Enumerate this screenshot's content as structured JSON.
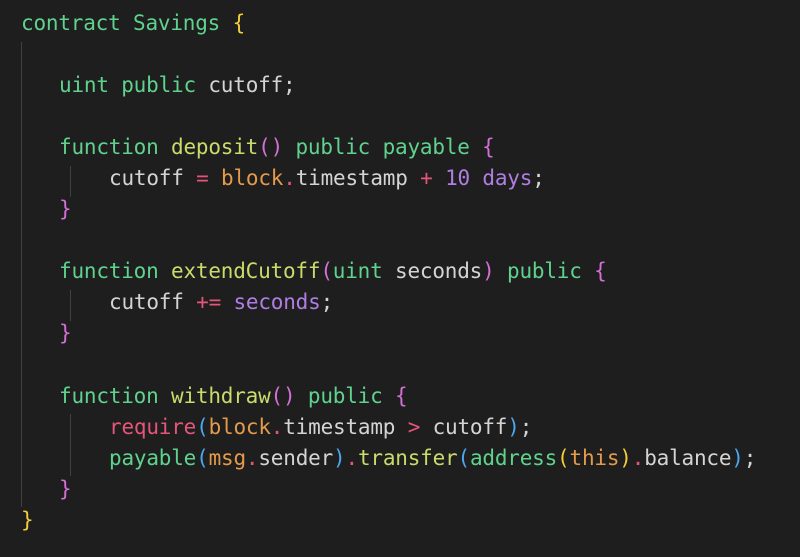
{
  "code": {
    "l1": {
      "t1": "contract",
      "t2": "Savings",
      "t3": "{"
    },
    "l2": {
      "t1": "uint",
      "t2": "public",
      "t3": "cutoff",
      "t4": ";"
    },
    "l3": {
      "t1": "function",
      "t2": "deposit",
      "t3": "(",
      "t4": ")",
      "t5": "public",
      "t6": "payable",
      "t7": "{"
    },
    "l4": {
      "t1": "cutoff",
      "t2": "=",
      "t3": "block",
      "t4": ".",
      "t5": "timestamp",
      "t6": "+",
      "t7": "10",
      "t8": "days",
      "t9": ";"
    },
    "l5": {
      "t1": "}"
    },
    "l6": {
      "t1": "function",
      "t2": "extendCutoff",
      "t3": "(",
      "t4": "uint",
      "t5": "seconds",
      "t6": ")",
      "t7": "public",
      "t8": "{"
    },
    "l7": {
      "t1": "cutoff",
      "t2": "+=",
      "t3": "seconds",
      "t4": ";"
    },
    "l8": {
      "t1": "}"
    },
    "l9": {
      "t1": "function",
      "t2": "withdraw",
      "t3": "(",
      "t4": ")",
      "t5": "public",
      "t6": "{"
    },
    "l10": {
      "t1": "require",
      "t2": "(",
      "t3": "block",
      "t4": ".",
      "t5": "timestamp",
      "t6": ">",
      "t7": "cutoff",
      "t8": ")",
      "t9": ";"
    },
    "l11": {
      "t1": "payable",
      "t2": "(",
      "t3": "msg",
      "t4": ".",
      "t5": "sender",
      "t6": ")",
      "t7": ".",
      "t8": "transfer",
      "t9": "(",
      "t10": "address",
      "t11": "(",
      "t12": "this",
      "t13": ")",
      "t14": ".",
      "t15": "balance",
      "t16": ")",
      "t17": ";"
    },
    "l12": {
      "t1": "}"
    },
    "l13": {
      "t1": "}"
    }
  },
  "colors": {
    "background": "#1e1e1e",
    "keyword": "#5fd38d",
    "function_name": "#c8dc6b",
    "identifier": "#d4d4d4",
    "bracket_level1": "#f2cd3b",
    "bracket_level2": "#d46fd6",
    "bracket_level3": "#4aa8f0",
    "operator": "#e5557a",
    "number": "#b07ee3",
    "object": "#e59a4b"
  }
}
